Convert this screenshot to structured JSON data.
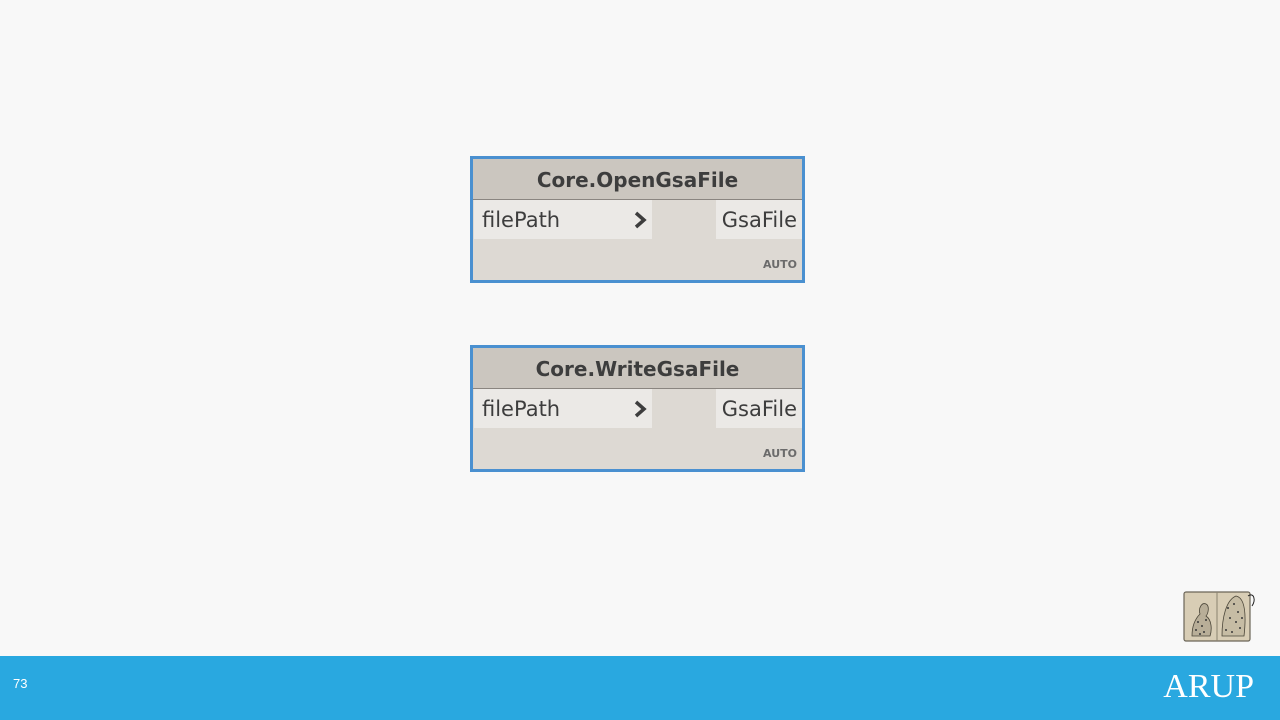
{
  "nodes": [
    {
      "title": "Core.OpenGsaFile",
      "input": "filePath",
      "output": "GsaFile",
      "lacing": "AUTO"
    },
    {
      "title": "Core.WriteGsaFile",
      "input": "filePath",
      "output": "GsaFile",
      "lacing": "AUTO"
    }
  ],
  "footer": {
    "page_number": "73",
    "logo": "ARUP",
    "background": "#29a8e0"
  },
  "colors": {
    "node_border": "#4a90d0",
    "node_header": "#cbc6bf",
    "node_body": "#ddd9d3"
  },
  "icons": {
    "port_arrow": "chevron-right-icon",
    "corner_image": "sketchbook-icon"
  }
}
